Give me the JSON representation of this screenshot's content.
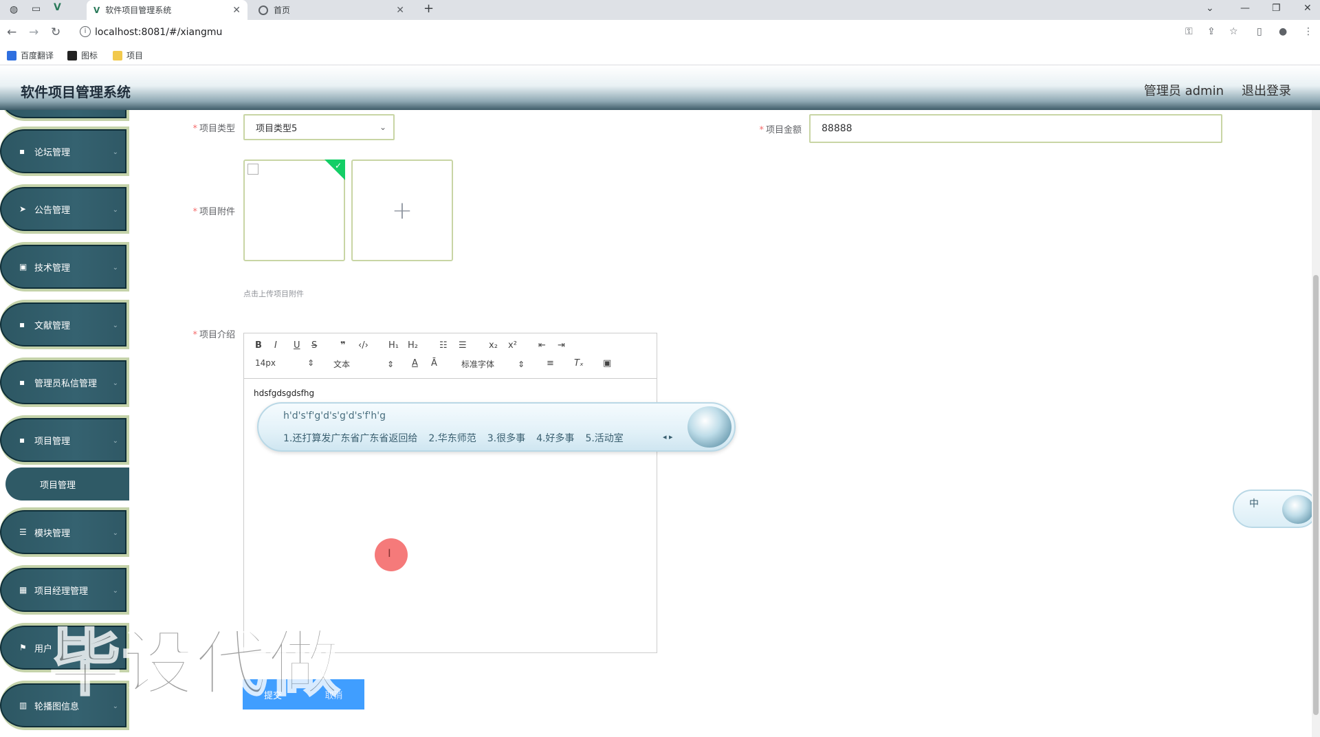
{
  "browser": {
    "tabs": [
      {
        "title": "软件项目管理系统",
        "active": true
      },
      {
        "title": "首页",
        "active": false
      }
    ],
    "new_tab": "+",
    "url": "localhost:8081/#/xiangmu",
    "bookmarks": [
      "百度翻译",
      "图标",
      "项目"
    ]
  },
  "header": {
    "app_title": "软件项目管理系统",
    "user": "管理员 admin",
    "logout": "退出登录"
  },
  "sidebar": {
    "items": [
      {
        "label": "论坛管理",
        "icon": "grid-icon"
      },
      {
        "label": "公告管理",
        "icon": "send-icon"
      },
      {
        "label": "技术管理",
        "icon": "clipboard-icon"
      },
      {
        "label": "文献管理",
        "icon": "grid-icon"
      },
      {
        "label": "管理员私信管理",
        "icon": "grid-icon"
      },
      {
        "label": "项目管理",
        "icon": "grid-icon"
      },
      {
        "label": "模块管理",
        "icon": "list-icon"
      },
      {
        "label": "项目经理管理",
        "icon": "grid-icon"
      },
      {
        "label": "用户",
        "icon": "flag-icon"
      },
      {
        "label": "轮播图信息",
        "icon": "chart-icon"
      }
    ],
    "submenu_active": "项目管理"
  },
  "form": {
    "type_label": "项目类型",
    "type_value": "项目类型5",
    "amount_label": "项目金额",
    "amount_value": "88888",
    "attachment_label": "项目附件",
    "upload_tip": "点击上传项目附件",
    "intro_label": "项目介绍",
    "editor": {
      "font_size": "14px",
      "block": "文本",
      "font": "标准字体",
      "content": "hdsfgdsgdsfhg"
    },
    "submit": "提交",
    "cancel": "取消"
  },
  "ime": {
    "composition": "h'd's'f'g'd's'g'd's'f'h'g",
    "candidates": [
      "1.还打算发广东省广东省返回给",
      "2.华东师范",
      "3.很多事",
      "4.好多事",
      "5.活动室"
    ],
    "mini_label": "中"
  },
  "watermark": "毕设代做",
  "colors": {
    "sidebar": "#2d5763",
    "accent_border": "#c5d3aa",
    "primary": "#409eff",
    "required": "#f56c6c"
  }
}
